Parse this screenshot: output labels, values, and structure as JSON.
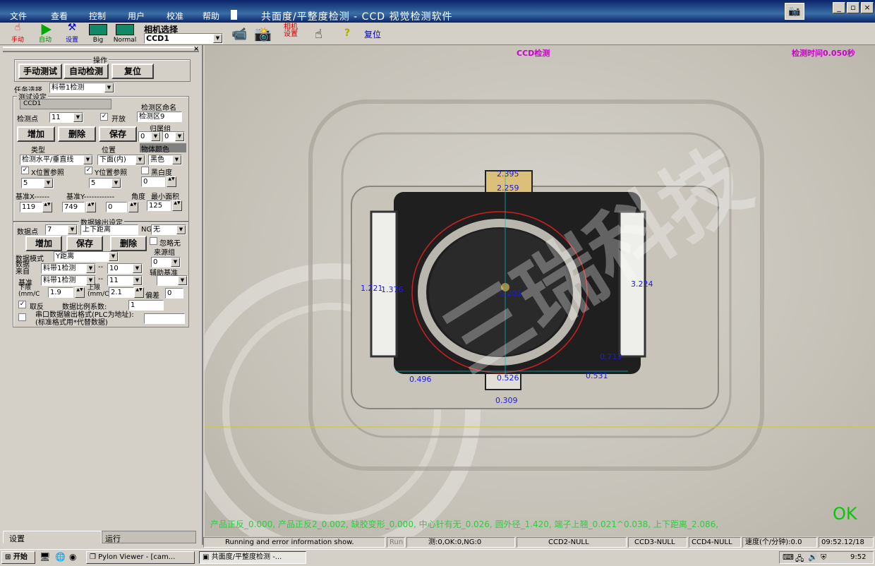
{
  "window": {
    "title": "共面度/平整度检测 - CCD 视觉检测软件",
    "menu": [
      "文件",
      "查看",
      "控制",
      "用户",
      "校准",
      "帮助"
    ]
  },
  "toolbar": {
    "items": [
      "手动",
      "自动",
      "设置",
      "Big",
      "Normal",
      "相机设置",
      "复位"
    ],
    "camera_select_label": "相机选择",
    "camera_value": "CCD1"
  },
  "panel": {
    "operation_title": "操作",
    "manual_test": "手动测试",
    "auto_detect": "自动检测",
    "reset": "复位",
    "task_select_label": "任务选择",
    "task_value": "料带1检测",
    "test_settings_title": "测试设定",
    "camera_tab": "CCD1",
    "zone_name_label": "检测区命名",
    "detect_point_label": "检测点",
    "detect_point_value": "11",
    "enable_label": "开放",
    "zone_name_value": "检测区9",
    "add": "增加",
    "delete": "删除",
    "save": "保存",
    "group_label": "归属组",
    "group_a": "0",
    "group_b": "0",
    "type_label": "类型",
    "position_label": "位置",
    "object_color_label": "物体颜色",
    "type_value": "检测水平/垂直线",
    "position_value": "下面(内)",
    "color_value": "黑色",
    "x_ref_label": "X位置参照",
    "y_ref_label": "Y位置参照",
    "black_white_label": "黑白度",
    "x_ref_value": "5",
    "y_ref_value": "5",
    "bw_value": "0",
    "base_x_label": "基准X------",
    "base_y_label": "基准Y------------",
    "angle_label": "角度",
    "min_area_label": "最小面积",
    "base_x_value": "119",
    "base_y_value": "749",
    "angle_value": "0",
    "min_area_value": "125",
    "output_title": "数据输出设定",
    "data_point_label": "数据点",
    "data_point_value": "7",
    "data_name_value": "上下距离",
    "ng_label": "NG",
    "ng_value": "无",
    "out_add": "增加",
    "out_save": "保存",
    "out_delete": "删除",
    "ignore_label": "忽略无",
    "source_group_label": "来源组",
    "data_mode_label": "数据模式",
    "data_mode_value": "Y距离",
    "source_group_value": "0",
    "data_from_label": "数据来自",
    "data_from_value": "料带1检测",
    "data_from_num": "10",
    "aux_base_label": "辅助基准",
    "base_label": "基准",
    "base_value": "料带1检测",
    "base_num": "11",
    "lower_label": "下限(mm/C",
    "lower_value": "1.9",
    "upper_label": "上限(mm/C",
    "upper_value": "2.1",
    "offset_label": "偏差",
    "offset_value": "0",
    "invert_label": "取反",
    "scale_label": "数据比例系数:",
    "scale_value": "1",
    "serial_label": "串口数据输出格式(PLC为地址):(标准格式用*代替数据)",
    "tab_settings": "设置",
    "tab_run": "运行"
  },
  "view": {
    "mode_label": "CCD检测",
    "time_label": "检测时间0.050秒",
    "measurements": [
      "2.395",
      "2.259",
      "1.221",
      "1.376",
      "3.224",
      "0.713",
      "0.496",
      "0.526",
      "0.531",
      "0.309",
      "0.201"
    ],
    "result_line": "产品正反_0.000, 产品正反2_0.002, 缺胶变形_0.000, 中心针有无_0.026, 圆外径_1.420, 端子上翘_0.021^0.038, 上下距离_2.086,",
    "ok": "OK",
    "watermark": "三瑞科技"
  },
  "status": {
    "message": "Running and error information show.",
    "run": "Run",
    "count": "测:0,OK:0,NG:0",
    "ccd2": "CCD2-NULL",
    "ccd3": "CCD3-NULL",
    "ccd4": "CCD4-NULL",
    "speed": "速度(个/分钟):0.0",
    "clock": "09:52.12/18"
  },
  "taskbar": {
    "start": "开始",
    "tasks": [
      "Pylon Viewer - [cam...",
      "共面度/平整度检测 -..."
    ],
    "time": "9:52"
  },
  "colors": {
    "title_bar": "#0a246a",
    "measurement": "#1a1aee",
    "result_text": "#2ecc40",
    "ok": "#00cc00",
    "label_magenta": "#cc00cc"
  }
}
